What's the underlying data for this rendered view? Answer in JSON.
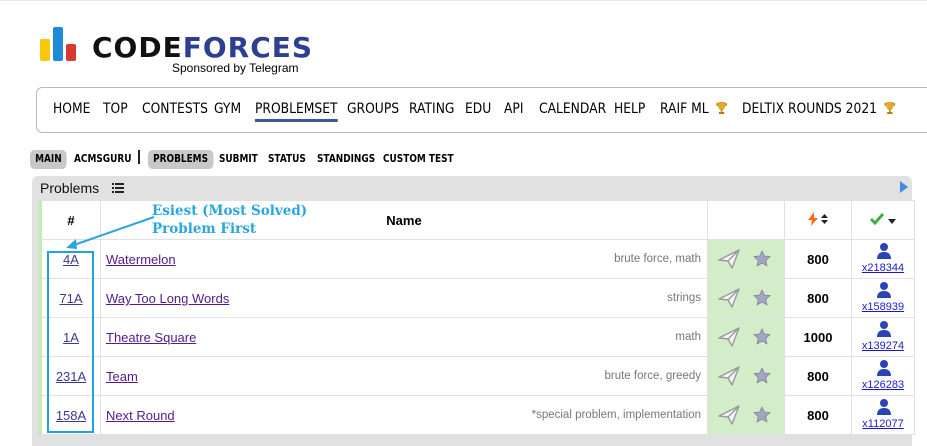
{
  "logo": {
    "word1": "CODE",
    "word2": "FORCES",
    "sponsor": "Sponsored by Telegram"
  },
  "menu": [
    {
      "label": "HOME",
      "active": false
    },
    {
      "label": "TOP",
      "active": false
    },
    {
      "label": "CONTESTS",
      "active": false
    },
    {
      "label": "GYM",
      "active": false
    },
    {
      "label": "PROBLEMSET",
      "active": true
    },
    {
      "label": "GROUPS",
      "active": false
    },
    {
      "label": "RATING",
      "active": false
    },
    {
      "label": "EDU",
      "active": false
    },
    {
      "label": "API",
      "active": false
    },
    {
      "label": "CALENDAR",
      "active": false
    },
    {
      "label": "HELP",
      "active": false
    },
    {
      "label": "RAIF ML",
      "active": false,
      "icon": "trophy-icon"
    },
    {
      "label": "DELTIX ROUNDS 2021",
      "active": false,
      "icon": "trophy-icon"
    }
  ],
  "submenu": {
    "left": [
      {
        "label": "MAIN",
        "selected": true
      },
      {
        "label": "ACMSGURU",
        "selected": false
      }
    ],
    "right": [
      {
        "label": "PROBLEMS",
        "selected": true
      },
      {
        "label": "SUBMIT",
        "selected": false
      },
      {
        "label": "STATUS",
        "selected": false
      },
      {
        "label": "STANDINGS",
        "selected": false
      },
      {
        "label": "CUSTOM TEST",
        "selected": false
      }
    ]
  },
  "panel": {
    "title": "Problems"
  },
  "table": {
    "headers": {
      "id": "#",
      "name": "Name"
    },
    "rows": [
      {
        "id": "4A",
        "name": "Watermelon",
        "tags": "brute force, math",
        "difficulty": "800",
        "solved": "x218344"
      },
      {
        "id": "71A",
        "name": "Way Too Long Words",
        "tags": "strings",
        "difficulty": "800",
        "solved": "x158939"
      },
      {
        "id": "1A",
        "name": "Theatre Square",
        "tags": "math",
        "difficulty": "1000",
        "solved": "x139274"
      },
      {
        "id": "231A",
        "name": "Team",
        "tags": "brute force, greedy",
        "difficulty": "800",
        "solved": "x126283"
      },
      {
        "id": "158A",
        "name": "Next Round",
        "tags": "*special problem, implementation",
        "difficulty": "800",
        "solved": "x112077"
      }
    ]
  },
  "annotation": {
    "line1": "Esiest (Most Solved)",
    "line2": "Problem First"
  },
  "colors": {
    "accent_blue": "#2d3f91",
    "annotation": "#2aa6df",
    "action_bg": "#d4edc9"
  }
}
